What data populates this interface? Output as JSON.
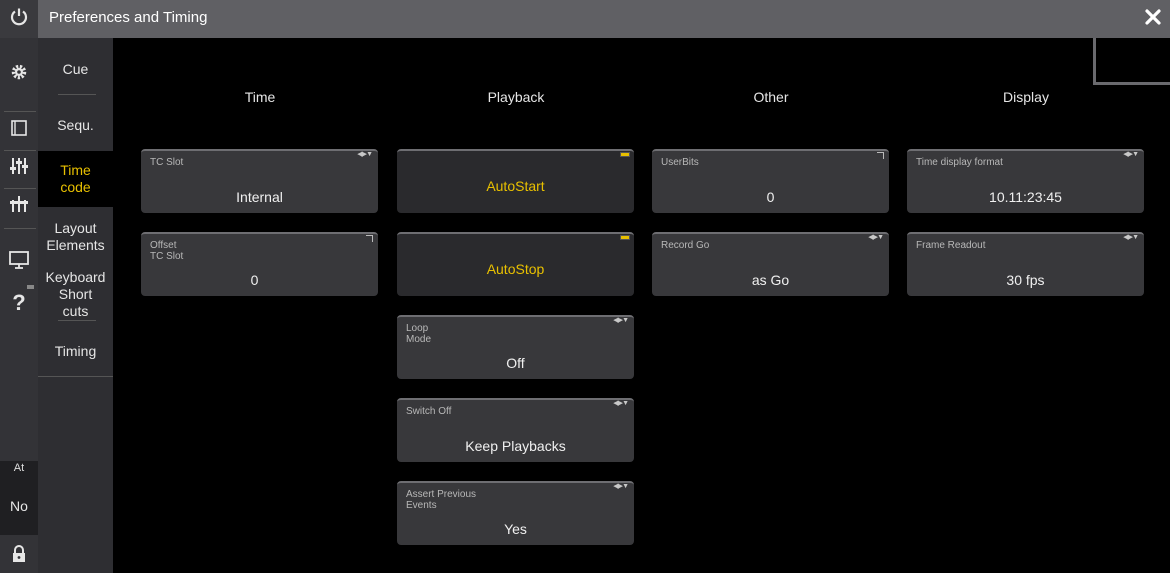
{
  "window": {
    "title": "Preferences and Timing"
  },
  "tabs": [
    {
      "label": "Cue",
      "selected": false
    },
    {
      "label": "Sequ.",
      "selected": false
    },
    {
      "label": "Time\ncode",
      "selected": true
    },
    {
      "label": "Layout\nElements",
      "selected": false
    },
    {
      "label": "Keyboard\nShort\ncuts",
      "selected": false
    },
    {
      "label": "Timing",
      "selected": false
    }
  ],
  "sidebar": {
    "at_label": "At",
    "no_label": "No"
  },
  "columns": {
    "time": "Time",
    "playback": "Playback",
    "other": "Other",
    "display": "Display"
  },
  "time": {
    "tc_slot": {
      "label": "TC Slot",
      "value": "Internal"
    },
    "offset_tc_slot": {
      "label": "Offset\nTC Slot",
      "value": "0"
    }
  },
  "playback": {
    "autostart": {
      "value": "AutoStart"
    },
    "autostop": {
      "value": "AutoStop"
    },
    "loop_mode": {
      "label": "Loop\nMode",
      "value": "Off"
    },
    "switch_off": {
      "label": "Switch Off",
      "value": "Keep Playbacks"
    },
    "assert_previous_events": {
      "label": "Assert Previous\nEvents",
      "value": "Yes"
    }
  },
  "other": {
    "userbits": {
      "label": "UserBits",
      "value": "0"
    },
    "record_go": {
      "label": "Record Go",
      "value": "as Go"
    }
  },
  "display": {
    "time_display_format": {
      "label": "Time display format",
      "value": "10.11:23:45"
    },
    "frame_readout": {
      "label": "Frame Readout",
      "value": "30 fps"
    }
  },
  "colors": {
    "accent": "#e8c000",
    "tile": "#38383b",
    "titlebar": "#606064"
  }
}
